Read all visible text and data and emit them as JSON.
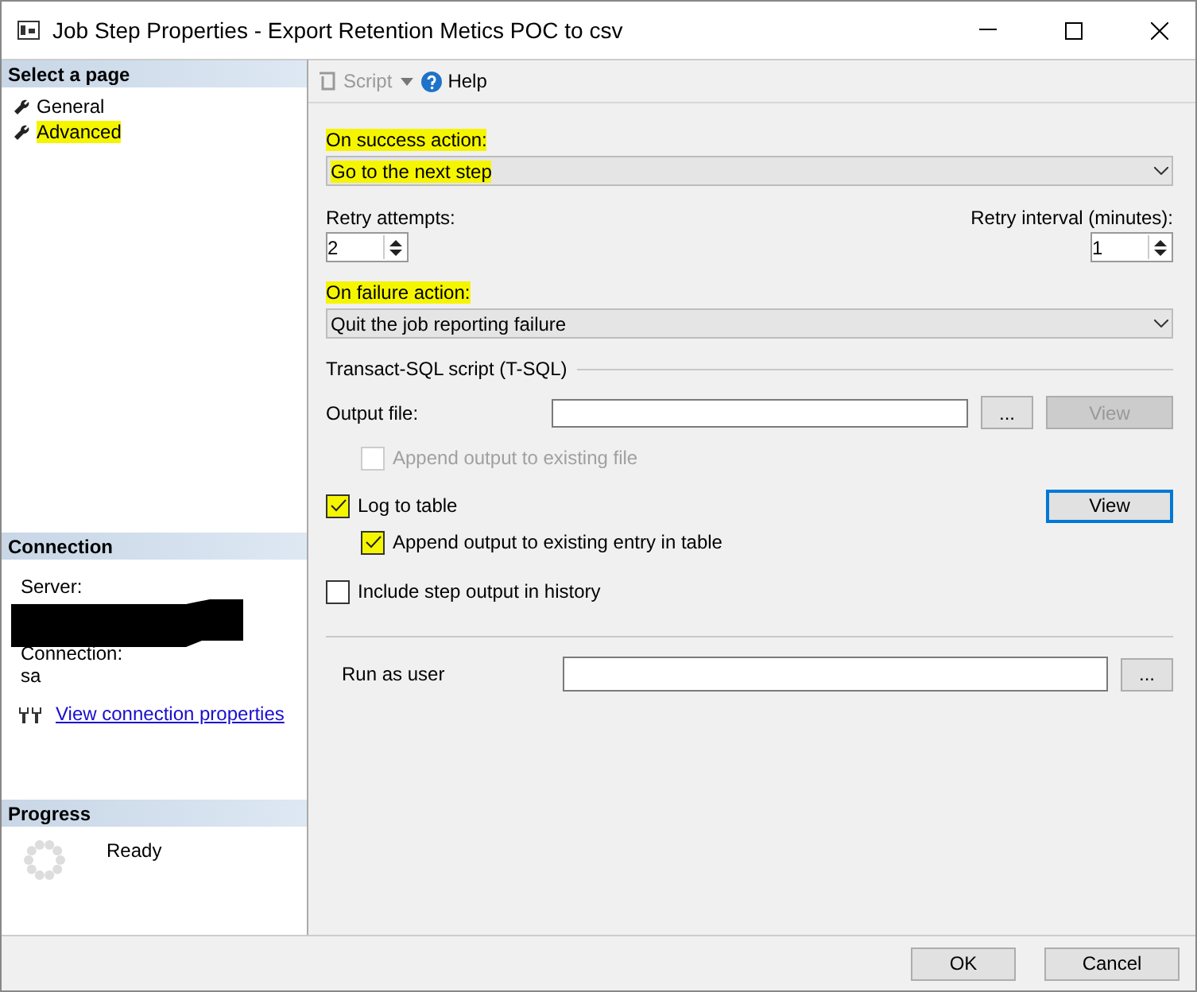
{
  "window": {
    "title": "Job Step Properties - Export Retention Metics POC to csv"
  },
  "sidebar": {
    "header": "Select a page",
    "items": [
      {
        "label": "General",
        "highlighted": false
      },
      {
        "label": "Advanced",
        "highlighted": true
      }
    ]
  },
  "connection": {
    "header": "Connection",
    "server_label": "Server:",
    "connection_label": "Connection:",
    "connection_value": "sa",
    "link": "View connection properties"
  },
  "progress": {
    "header": "Progress",
    "status": "Ready"
  },
  "toolbar": {
    "script": {
      "label": "Script",
      "disabled": true
    },
    "help": "Help"
  },
  "on_success": {
    "label": "On success action:",
    "value": "Go to the next step",
    "highlighted": true
  },
  "retry_attempts": {
    "label": "Retry attempts:",
    "value": "2"
  },
  "retry_interval": {
    "label": "Retry interval (minutes):",
    "value": "1"
  },
  "on_failure": {
    "label": "On failure action:",
    "value": "Quit the job reporting failure",
    "highlighted": true
  },
  "tsql": {
    "title": "Transact-SQL script (T-SQL)",
    "output_file_label": "Output file:",
    "browse": "...",
    "view": {
      "label": "View",
      "disabled": true
    }
  },
  "append_file": {
    "label": "Append output to existing file",
    "checked": false,
    "disabled": true,
    "highlighted": false
  },
  "checkboxes": [
    {
      "label": "Log to table",
      "checked": true,
      "disabled": false,
      "highlighted": true,
      "button": "View",
      "children": [
        {
          "label": "Append output to existing entry in table",
          "checked": true,
          "disabled": false,
          "highlighted": true
        }
      ]
    },
    {
      "label": "Include step output in history",
      "checked": false,
      "disabled": false,
      "highlighted": false
    }
  ],
  "run_as": {
    "label": "Run as user",
    "browse": "..."
  },
  "buttons": [
    {
      "label": "OK"
    },
    {
      "label": "Cancel"
    }
  ]
}
